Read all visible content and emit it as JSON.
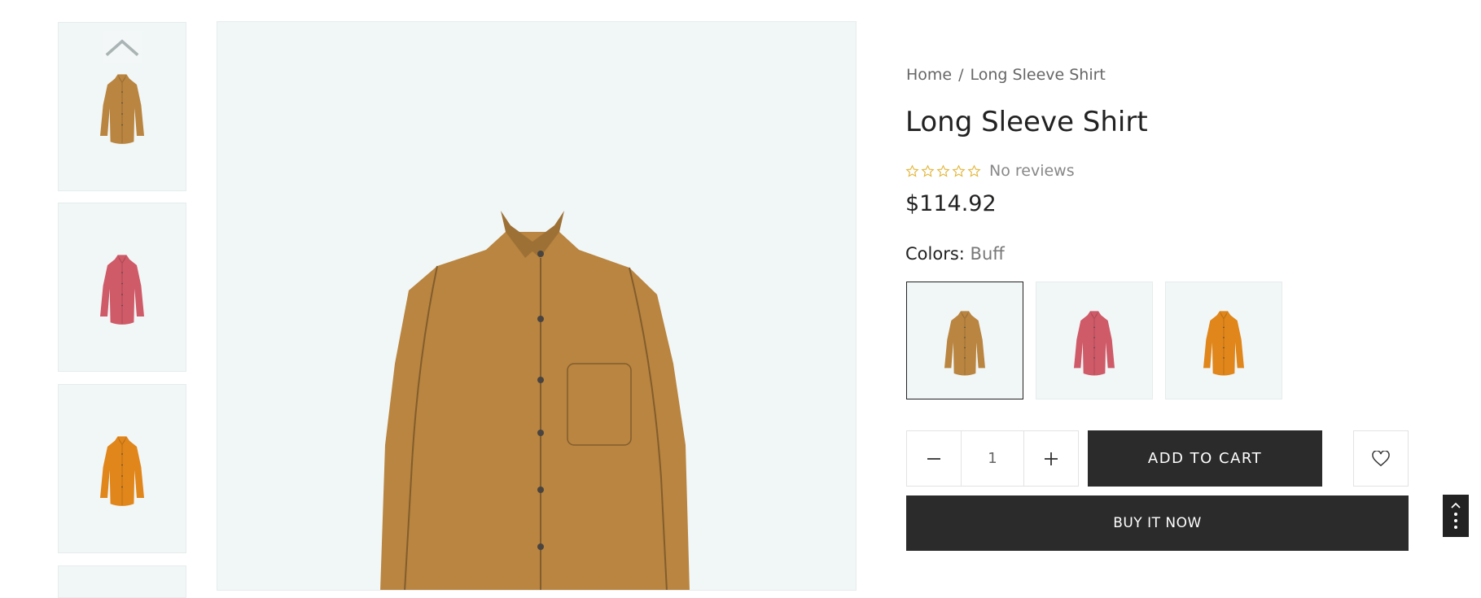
{
  "gallery": {
    "thumbnails": [
      {
        "color_name": "Buff",
        "hex": "#b98540"
      },
      {
        "color_name": "Pink",
        "hex": "#cf5a68"
      },
      {
        "color_name": "Orange",
        "hex": "#e0861b"
      }
    ],
    "scroll_up_icon": "chevron-up-icon",
    "main_image_hex": "#b98540"
  },
  "breadcrumb": {
    "home": "Home",
    "separator": "/",
    "current": "Long Sleeve Shirt"
  },
  "product": {
    "title": "Long Sleeve Shirt",
    "rating": 0,
    "rating_max": 5,
    "reviews_text": "No reviews",
    "price": "$114.92",
    "colors_label": "Colors:",
    "selected_color": "Buff",
    "star_color": "#e2b73e"
  },
  "swatches": [
    {
      "name": "Buff",
      "hex": "#b98540",
      "selected": true
    },
    {
      "name": "Pink",
      "hex": "#cf5a68",
      "selected": false
    },
    {
      "name": "Orange",
      "hex": "#e0861b",
      "selected": false
    }
  ],
  "purchase": {
    "quantity": "1",
    "minus_icon": "minus-icon",
    "plus_icon": "plus-icon",
    "add_to_cart_label": "ADD TO CART",
    "wishlist_icon": "heart-icon",
    "buy_now_label": "BUY IT NOW"
  },
  "floating": {
    "icon": "chevron-up-icon",
    "more_icon": "more-vertical-icon"
  }
}
